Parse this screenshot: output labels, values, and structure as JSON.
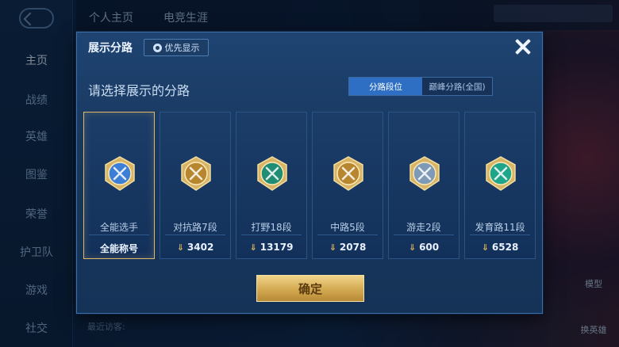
{
  "nav": {
    "items": [
      "主页",
      "战绩",
      "英雄",
      "图鉴",
      "荣誉",
      "护卫队",
      "游戏",
      "社交"
    ],
    "active_index": 0
  },
  "top_tabs": [
    "个人主页",
    "电竞生涯"
  ],
  "visitors_label": "最近访客:",
  "side_buttons": [
    "模型",
    "换英雄"
  ],
  "modal": {
    "title": "展示分路",
    "priority_button": "优先显示",
    "subtitle": "请选择展示的分路",
    "segments": [
      {
        "label": "分路段位",
        "active": true
      },
      {
        "label": "巅峰分路(全国)",
        "active": false
      }
    ],
    "cards": [
      {
        "name": "全能选手",
        "stat": "全能称号",
        "selected": true,
        "icon": "all-round-emblem-icon",
        "color": "#3c7fd8"
      },
      {
        "name": "对抗路7段",
        "stat": "3402",
        "selected": false,
        "icon": "clash-lane-emblem-icon",
        "color": "#b8862e"
      },
      {
        "name": "打野18段",
        "stat": "13179",
        "selected": false,
        "icon": "jungle-emblem-icon",
        "color": "#1f8e74"
      },
      {
        "name": "中路5段",
        "stat": "2078",
        "selected": false,
        "icon": "mid-lane-emblem-icon",
        "color": "#b8862e"
      },
      {
        "name": "游走2段",
        "stat": "600",
        "selected": false,
        "icon": "roam-emblem-icon",
        "color": "#7d9ab8"
      },
      {
        "name": "发育路11段",
        "stat": "6528",
        "selected": false,
        "icon": "farm-lane-emblem-icon",
        "color": "#1fa68a"
      }
    ],
    "confirm_label": "确定"
  }
}
